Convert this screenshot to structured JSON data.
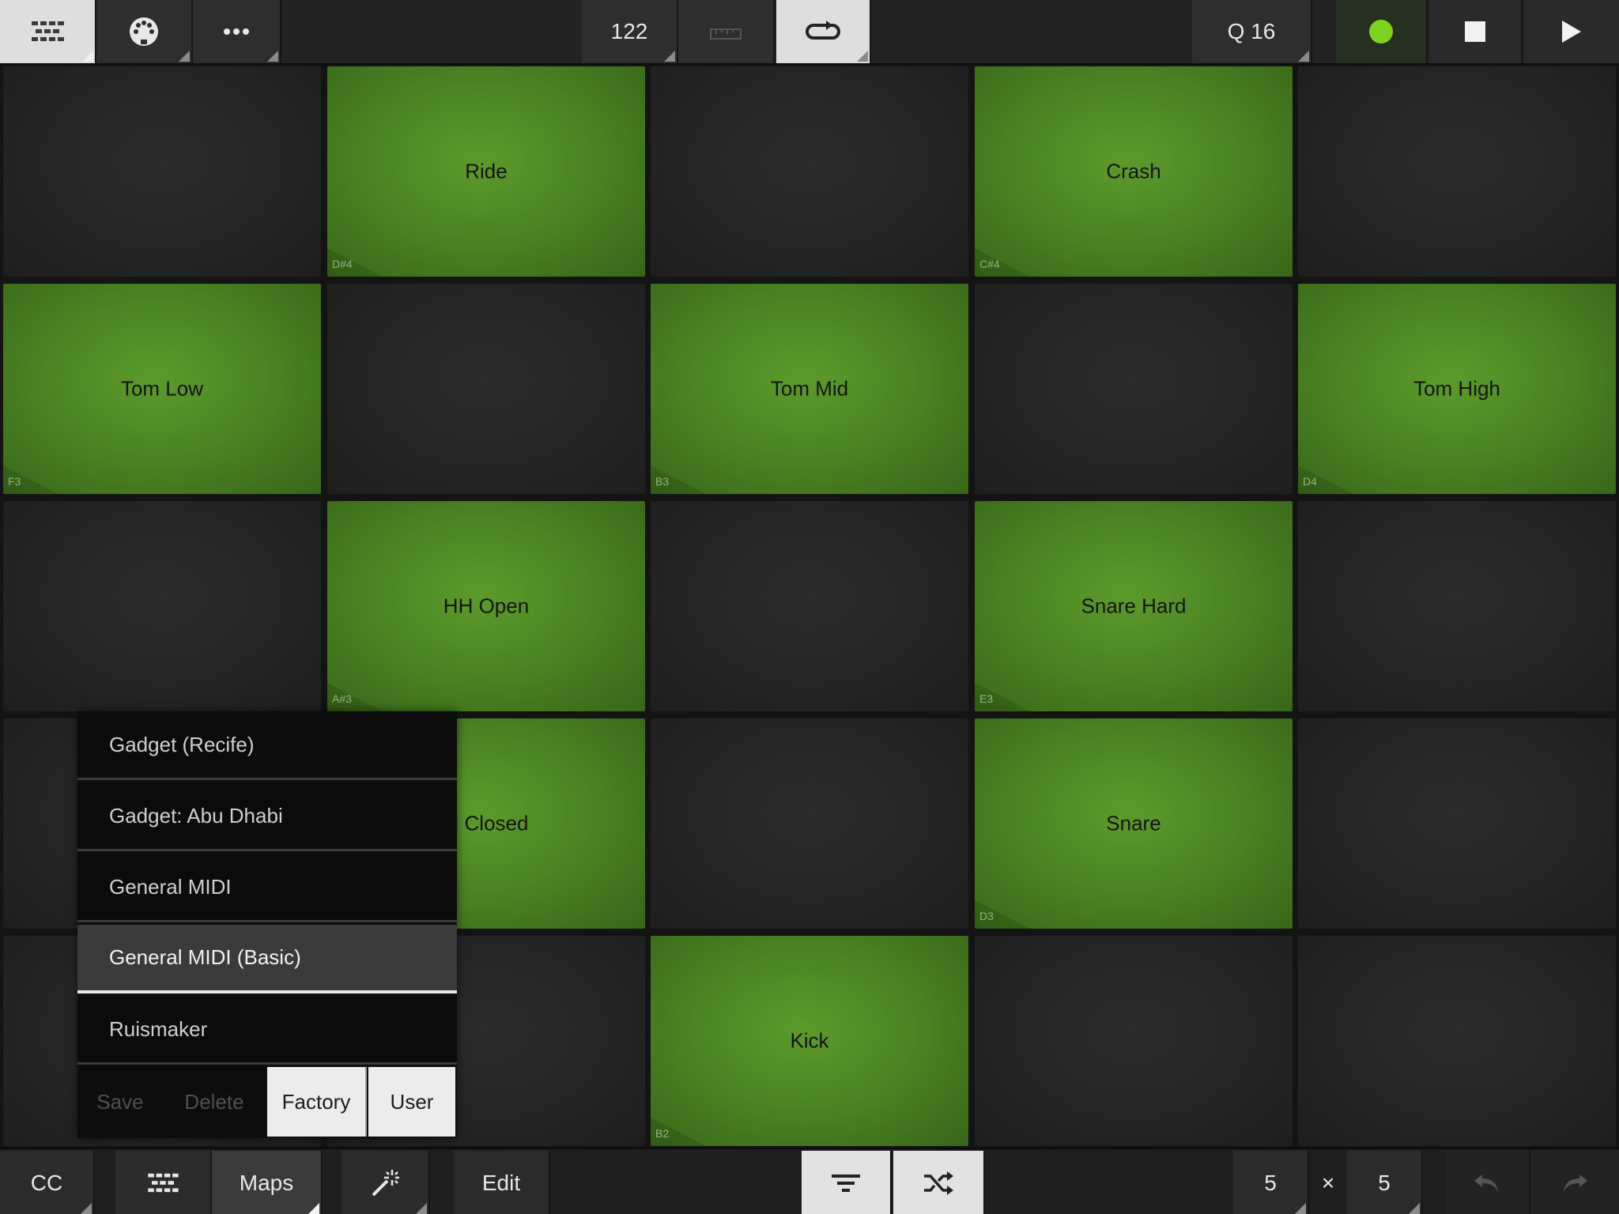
{
  "topbar": {
    "tempo": "122",
    "quantize": "Q 16",
    "icons": [
      "pads-grid-icon",
      "midi-port-icon",
      "more-icon",
      "metronome-icon",
      "loop-icon",
      "record-icon",
      "stop-icon",
      "play-icon"
    ],
    "record_color": "#7ed321"
  },
  "pads": [
    {
      "label": "",
      "note": "",
      "on": false
    },
    {
      "label": "Ride",
      "note": "D#4",
      "on": true
    },
    {
      "label": "",
      "note": "",
      "on": false
    },
    {
      "label": "Crash",
      "note": "C#4",
      "on": true
    },
    {
      "label": "",
      "note": "",
      "on": false
    },
    {
      "label": "Tom Low",
      "note": "F3",
      "on": true
    },
    {
      "label": "",
      "note": "",
      "on": false
    },
    {
      "label": "Tom Mid",
      "note": "B3",
      "on": true
    },
    {
      "label": "",
      "note": "",
      "on": false
    },
    {
      "label": "Tom High",
      "note": "D4",
      "on": true
    },
    {
      "label": "",
      "note": "",
      "on": false
    },
    {
      "label": "HH Open",
      "note": "A#3",
      "on": true
    },
    {
      "label": "",
      "note": "",
      "on": false
    },
    {
      "label": "Snare Hard",
      "note": "E3",
      "on": true
    },
    {
      "label": "",
      "note": "",
      "on": false
    },
    {
      "label": "",
      "note": "",
      "on": false
    },
    {
      "label": "H Closed",
      "note": "",
      "on": true
    },
    {
      "label": "",
      "note": "",
      "on": false
    },
    {
      "label": "Snare",
      "note": "D3",
      "on": true
    },
    {
      "label": "",
      "note": "",
      "on": false
    },
    {
      "label": "",
      "note": "",
      "on": false
    },
    {
      "label": "",
      "note": "",
      "on": false
    },
    {
      "label": "Kick",
      "note": "B2",
      "on": true
    },
    {
      "label": "",
      "note": "",
      "on": false
    },
    {
      "label": "",
      "note": "",
      "on": false
    }
  ],
  "map_menu": {
    "items": [
      {
        "label": "Gadget (Recife)",
        "selected": false
      },
      {
        "label": "Gadget: Abu Dhabi",
        "selected": false
      },
      {
        "label": "General MIDI",
        "selected": false
      },
      {
        "label": "General MIDI (Basic)",
        "selected": true
      },
      {
        "label": "Ruismaker",
        "selected": false
      }
    ],
    "buttons": {
      "save": "Save",
      "delete": "Delete",
      "factory": "Factory",
      "user": "User"
    }
  },
  "bottombar": {
    "cc": "CC",
    "maps": "Maps",
    "edit": "Edit",
    "cols": "5",
    "times": "×",
    "rows": "5",
    "icons": [
      "pads-grid-icon",
      "magic-wand-icon",
      "sort-icon",
      "shuffle-icon",
      "undo-icon",
      "redo-icon"
    ]
  },
  "colors": {
    "pad_on": "#4c8524",
    "pad_off": "#252525",
    "accent_light": "#e2e2e2"
  }
}
